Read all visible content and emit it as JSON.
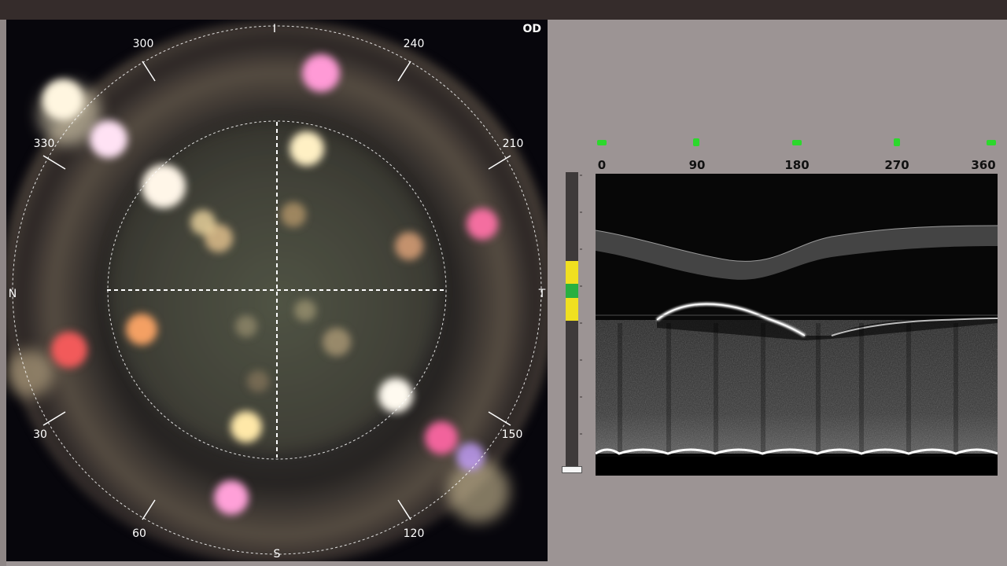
{
  "eye_label": "OD",
  "fundus": {
    "compass": {
      "top": "I",
      "bottom": "S",
      "left": "N",
      "right": "T"
    },
    "angle_labels": [
      "300",
      "240",
      "330",
      "210",
      "30",
      "150",
      "60",
      "120"
    ]
  },
  "bscan": {
    "x_labels": [
      "0",
      "90",
      "180",
      "270",
      "360"
    ],
    "marker_color": "#2cd82c"
  },
  "signal_scale": {
    "colors": {
      "track": "#3e3a3a",
      "yellow": "#f0e020",
      "green": "#28b040",
      "handle": "#f6f6f6"
    }
  }
}
